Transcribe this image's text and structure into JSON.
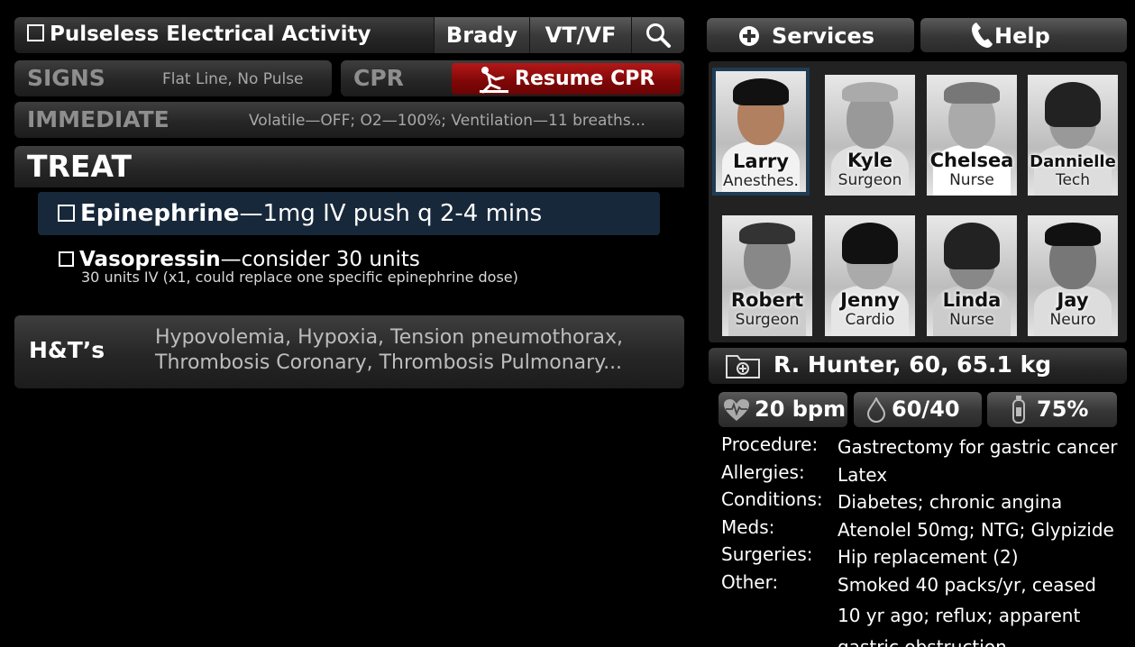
{
  "header": {
    "title": "Pulseless Electrical Activity",
    "tabs": [
      "Brady",
      "VT/VF"
    ]
  },
  "signs": {
    "label": "SIGNS",
    "value": "Flat Line, No Pulse"
  },
  "cpr": {
    "label": "CPR",
    "button": "Resume CPR",
    "button_color": "#9b0b0b"
  },
  "immediate": {
    "label": "IMMEDIATE",
    "value": "Volatile—OFF; O2—100%; Ventilation—11 breaths..."
  },
  "treat": {
    "label": "TREAT",
    "items": [
      {
        "name": "Epinephrine",
        "detail": "—1mg IV push q 2-4 mins"
      },
      {
        "name": "Vasopressin",
        "detail": "—consider 30 units",
        "sub": "30 units IV (x1, could replace one specific epinephrine dose)"
      }
    ]
  },
  "ht": {
    "label": "H&T’s",
    "lines": [
      "Hypovolemia, Hypoxia, Tension pneumothorax,",
      "Thrombosis Coronary, Thrombosis Pulmonary..."
    ]
  },
  "services": {
    "label": "Services"
  },
  "help": {
    "label": "Help"
  },
  "staff": [
    {
      "name": "Larry",
      "role": "Anesthes."
    },
    {
      "name": "Kyle",
      "role": "Surgeon"
    },
    {
      "name": "Chelsea",
      "role": "Nurse"
    },
    {
      "name": "Dannielle",
      "role": "Tech"
    },
    {
      "name": "Robert",
      "role": "Surgeon"
    },
    {
      "name": "Jenny",
      "role": "Cardio"
    },
    {
      "name": "Linda",
      "role": "Nurse"
    },
    {
      "name": "Jay",
      "role": "Neuro"
    }
  ],
  "patient": {
    "summary": "R. Hunter, 60, 65.1 kg"
  },
  "vitals": {
    "heart_rate": "20 bpm",
    "blood_pressure": "60/40",
    "oxygen": "75%"
  },
  "history": {
    "procedure": {
      "label": "Procedure:",
      "value": "Gastrectomy for gastric cancer"
    },
    "allergies": {
      "label": "Allergies:",
      "value": "Latex"
    },
    "conditions": {
      "label": "Conditions:",
      "value": "Diabetes; chronic angina"
    },
    "meds": {
      "label": "Meds:",
      "value": "Atenolel 50mg; NTG; Glypizide"
    },
    "surgeries": {
      "label": "Surgeries:",
      "value": "Hip replacement (2)"
    },
    "other": {
      "label": "Other:",
      "lines": [
        "Smoked 40 packs/yr, ceased",
        "10 yr ago; reflux; apparent",
        "gastric obstruction"
      ]
    }
  }
}
